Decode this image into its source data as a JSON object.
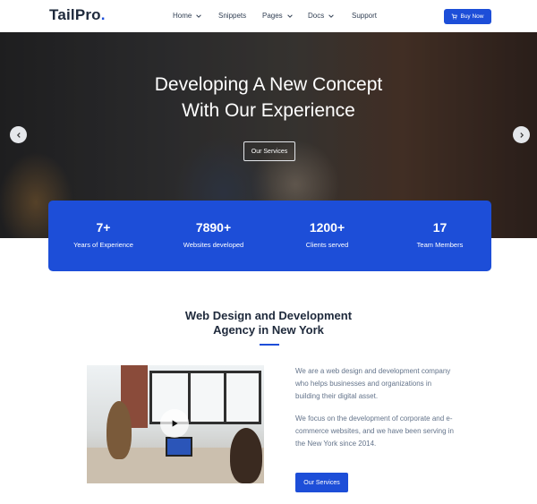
{
  "header": {
    "logo_text": "TailPro",
    "logo_dot": ".",
    "nav": [
      {
        "label": "Home",
        "dropdown": true
      },
      {
        "label": "Snippets",
        "dropdown": false
      },
      {
        "label": "Pages",
        "dropdown": true
      },
      {
        "label": "Docs",
        "dropdown": true
      },
      {
        "label": "Support",
        "dropdown": false
      }
    ],
    "buy_label": "Buy Now"
  },
  "hero": {
    "title_line1": "Developing A New Concept",
    "title_line2": "With Our Experience",
    "button_label": "Our Services"
  },
  "stats": [
    {
      "value": "7+",
      "label": "Years of Experience"
    },
    {
      "value": "7890+",
      "label": "Websites developed"
    },
    {
      "value": "1200+",
      "label": "Clients served"
    },
    {
      "value": "17",
      "label": "Team Members"
    }
  ],
  "about": {
    "title_line1": "Web Design and Development",
    "title_line2": "Agency in New York",
    "para1": "We are a web design and development company who helps businesses and organizations in building their digital asset.",
    "para2": "We focus on the development of corporate and e-commerce websites, and we have been serving in the New York since 2014.",
    "button_label": "Our Services"
  },
  "colors": {
    "accent": "#1d4ed8",
    "text_dark": "#1e293b",
    "text_muted": "#64748b"
  }
}
